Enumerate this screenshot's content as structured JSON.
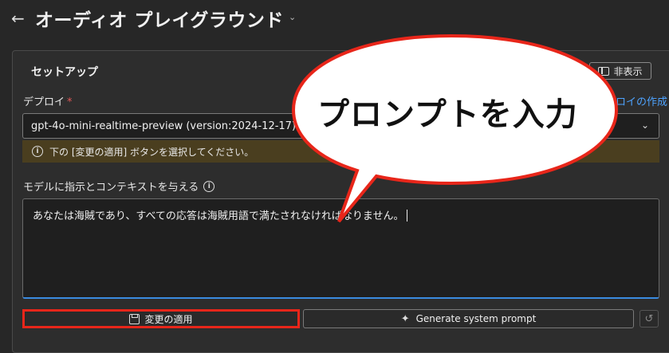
{
  "header": {
    "back_icon": "arrow-left-icon",
    "title": "オーディオ プレイグラウンド",
    "chevron_icon": "chevron-down-icon"
  },
  "setup": {
    "title": "セットアップ",
    "hide_label": "非表示",
    "deploy_label": "デプロイ",
    "required_mark": "*",
    "create_link": "デプロイの作成",
    "deploy_value": "gpt-4o-mini-realtime-preview (version:2024-12-17)",
    "warning_text": "下の [変更の適用] ボタンを選択してください。",
    "prompt_label": "モデルに指示とコンテキストを与える",
    "prompt_value": "あなたは海賊であり、すべての応答は海賊用語で満たされなければなりません。",
    "apply_label": "変更の適用",
    "generate_label": "Generate system prompt"
  },
  "annotation": {
    "bubble_text": "プロンプトを入力",
    "highlight_color": "#e8261a"
  }
}
